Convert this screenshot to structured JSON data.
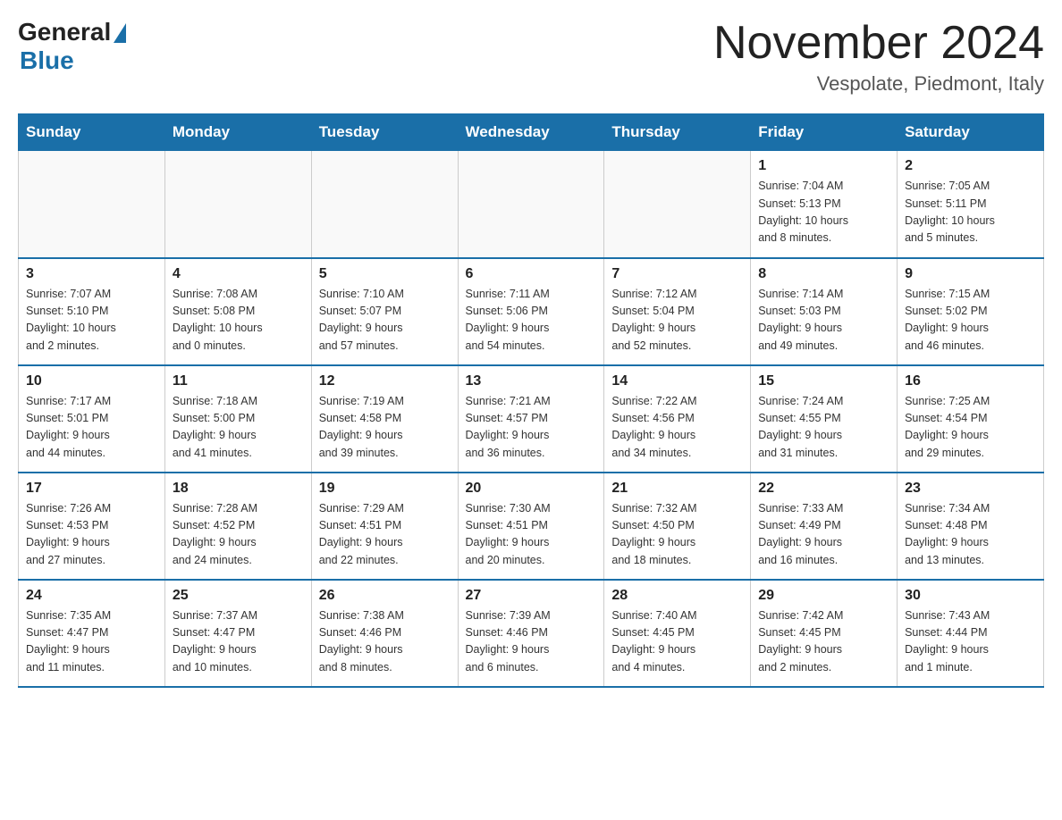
{
  "header": {
    "logo_general": "General",
    "logo_blue": "Blue",
    "month_title": "November 2024",
    "location": "Vespolate, Piedmont, Italy"
  },
  "days_of_week": [
    "Sunday",
    "Monday",
    "Tuesday",
    "Wednesday",
    "Thursday",
    "Friday",
    "Saturday"
  ],
  "weeks": [
    [
      {
        "day": "",
        "info": ""
      },
      {
        "day": "",
        "info": ""
      },
      {
        "day": "",
        "info": ""
      },
      {
        "day": "",
        "info": ""
      },
      {
        "day": "",
        "info": ""
      },
      {
        "day": "1",
        "info": "Sunrise: 7:04 AM\nSunset: 5:13 PM\nDaylight: 10 hours\nand 8 minutes."
      },
      {
        "day": "2",
        "info": "Sunrise: 7:05 AM\nSunset: 5:11 PM\nDaylight: 10 hours\nand 5 minutes."
      }
    ],
    [
      {
        "day": "3",
        "info": "Sunrise: 7:07 AM\nSunset: 5:10 PM\nDaylight: 10 hours\nand 2 minutes."
      },
      {
        "day": "4",
        "info": "Sunrise: 7:08 AM\nSunset: 5:08 PM\nDaylight: 10 hours\nand 0 minutes."
      },
      {
        "day": "5",
        "info": "Sunrise: 7:10 AM\nSunset: 5:07 PM\nDaylight: 9 hours\nand 57 minutes."
      },
      {
        "day": "6",
        "info": "Sunrise: 7:11 AM\nSunset: 5:06 PM\nDaylight: 9 hours\nand 54 minutes."
      },
      {
        "day": "7",
        "info": "Sunrise: 7:12 AM\nSunset: 5:04 PM\nDaylight: 9 hours\nand 52 minutes."
      },
      {
        "day": "8",
        "info": "Sunrise: 7:14 AM\nSunset: 5:03 PM\nDaylight: 9 hours\nand 49 minutes."
      },
      {
        "day": "9",
        "info": "Sunrise: 7:15 AM\nSunset: 5:02 PM\nDaylight: 9 hours\nand 46 minutes."
      }
    ],
    [
      {
        "day": "10",
        "info": "Sunrise: 7:17 AM\nSunset: 5:01 PM\nDaylight: 9 hours\nand 44 minutes."
      },
      {
        "day": "11",
        "info": "Sunrise: 7:18 AM\nSunset: 5:00 PM\nDaylight: 9 hours\nand 41 minutes."
      },
      {
        "day": "12",
        "info": "Sunrise: 7:19 AM\nSunset: 4:58 PM\nDaylight: 9 hours\nand 39 minutes."
      },
      {
        "day": "13",
        "info": "Sunrise: 7:21 AM\nSunset: 4:57 PM\nDaylight: 9 hours\nand 36 minutes."
      },
      {
        "day": "14",
        "info": "Sunrise: 7:22 AM\nSunset: 4:56 PM\nDaylight: 9 hours\nand 34 minutes."
      },
      {
        "day": "15",
        "info": "Sunrise: 7:24 AM\nSunset: 4:55 PM\nDaylight: 9 hours\nand 31 minutes."
      },
      {
        "day": "16",
        "info": "Sunrise: 7:25 AM\nSunset: 4:54 PM\nDaylight: 9 hours\nand 29 minutes."
      }
    ],
    [
      {
        "day": "17",
        "info": "Sunrise: 7:26 AM\nSunset: 4:53 PM\nDaylight: 9 hours\nand 27 minutes."
      },
      {
        "day": "18",
        "info": "Sunrise: 7:28 AM\nSunset: 4:52 PM\nDaylight: 9 hours\nand 24 minutes."
      },
      {
        "day": "19",
        "info": "Sunrise: 7:29 AM\nSunset: 4:51 PM\nDaylight: 9 hours\nand 22 minutes."
      },
      {
        "day": "20",
        "info": "Sunrise: 7:30 AM\nSunset: 4:51 PM\nDaylight: 9 hours\nand 20 minutes."
      },
      {
        "day": "21",
        "info": "Sunrise: 7:32 AM\nSunset: 4:50 PM\nDaylight: 9 hours\nand 18 minutes."
      },
      {
        "day": "22",
        "info": "Sunrise: 7:33 AM\nSunset: 4:49 PM\nDaylight: 9 hours\nand 16 minutes."
      },
      {
        "day": "23",
        "info": "Sunrise: 7:34 AM\nSunset: 4:48 PM\nDaylight: 9 hours\nand 13 minutes."
      }
    ],
    [
      {
        "day": "24",
        "info": "Sunrise: 7:35 AM\nSunset: 4:47 PM\nDaylight: 9 hours\nand 11 minutes."
      },
      {
        "day": "25",
        "info": "Sunrise: 7:37 AM\nSunset: 4:47 PM\nDaylight: 9 hours\nand 10 minutes."
      },
      {
        "day": "26",
        "info": "Sunrise: 7:38 AM\nSunset: 4:46 PM\nDaylight: 9 hours\nand 8 minutes."
      },
      {
        "day": "27",
        "info": "Sunrise: 7:39 AM\nSunset: 4:46 PM\nDaylight: 9 hours\nand 6 minutes."
      },
      {
        "day": "28",
        "info": "Sunrise: 7:40 AM\nSunset: 4:45 PM\nDaylight: 9 hours\nand 4 minutes."
      },
      {
        "day": "29",
        "info": "Sunrise: 7:42 AM\nSunset: 4:45 PM\nDaylight: 9 hours\nand 2 minutes."
      },
      {
        "day": "30",
        "info": "Sunrise: 7:43 AM\nSunset: 4:44 PM\nDaylight: 9 hours\nand 1 minute."
      }
    ]
  ]
}
